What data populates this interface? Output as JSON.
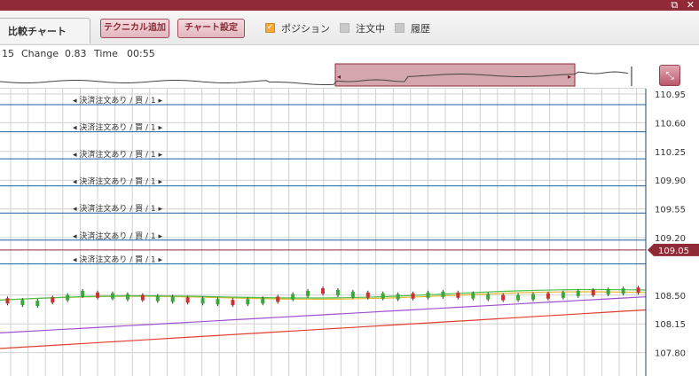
{
  "window": {
    "controls": "⧉ ✕"
  },
  "toolbar": {
    "compare_tab": "比較チャート",
    "technical_button": "テクニカル追加",
    "chart_settings_button": "チャート設定",
    "checks": [
      {
        "label": "ポジション",
        "checked": true
      },
      {
        "label": "注文中",
        "checked": false
      },
      {
        "label": "履歴",
        "checked": false
      }
    ]
  },
  "info": {
    "time_prefix": "15",
    "change_label": "Change",
    "change_value": "0.83",
    "time_label": "Time",
    "time_value": "00:55"
  },
  "navigator": {
    "resize_icon": "⤡"
  },
  "chart_data": {
    "type": "candlestick",
    "y_ticks": [
      "110.95",
      "110.60",
      "110.25",
      "109.90",
      "109.55",
      "109.20",
      "109.05",
      "108.50",
      "108.15",
      "107.80"
    ],
    "ylim": [
      107.45,
      110.95
    ],
    "current_price": "109.05",
    "current_price_color": "#8f2a36",
    "order_lines": [
      {
        "label": "◂ 決済注文あり / 買 / 1 ▸",
        "price": 110.82
      },
      {
        "label": "◂ 決済注文あり / 買 / 1 ▸",
        "price": 110.49
      },
      {
        "label": "◂ 決済注文あり / 買 / 1 ▸",
        "price": 110.16
      },
      {
        "label": "◂ 決済注文あり / 買 / 1 ▸",
        "price": 109.83
      },
      {
        "label": "◂ 決済注文あり / 買 / 1 ▸",
        "price": 109.5
      },
      {
        "label": "◂ 決済注文あり / 買 / 1 ▸",
        "price": 109.17
      },
      {
        "label": "◂ 決済注文あり / 買 / 1 ▸",
        "price": 108.88
      }
    ],
    "series": [
      {
        "name": "",
        "color": "#e04030",
        "values": [
          107.85,
          108.32
        ]
      },
      {
        "name": "",
        "color": "#a050d0",
        "values": [
          108.04,
          108.48
        ]
      },
      {
        "name": "",
        "color": "#e8b830",
        "values": [
          108.44,
          108.52
        ]
      },
      {
        "name": "",
        "color": "#4cbf4c",
        "values": [
          108.44,
          108.55
        ]
      }
    ],
    "candles": [
      108.43,
      108.41,
      108.4,
      108.44,
      108.47,
      108.52,
      108.5,
      108.49,
      108.48,
      108.47,
      108.46,
      108.45,
      108.44,
      108.43,
      108.42,
      108.41,
      108.42,
      108.43,
      108.45,
      108.48,
      108.52,
      108.55,
      108.53,
      108.51,
      108.5,
      108.49,
      108.48,
      108.49,
      108.5,
      108.51,
      108.5,
      108.49,
      108.48,
      108.47,
      108.47,
      108.48,
      108.49,
      108.5,
      108.52,
      108.53,
      108.54,
      108.55,
      108.56
    ]
  }
}
